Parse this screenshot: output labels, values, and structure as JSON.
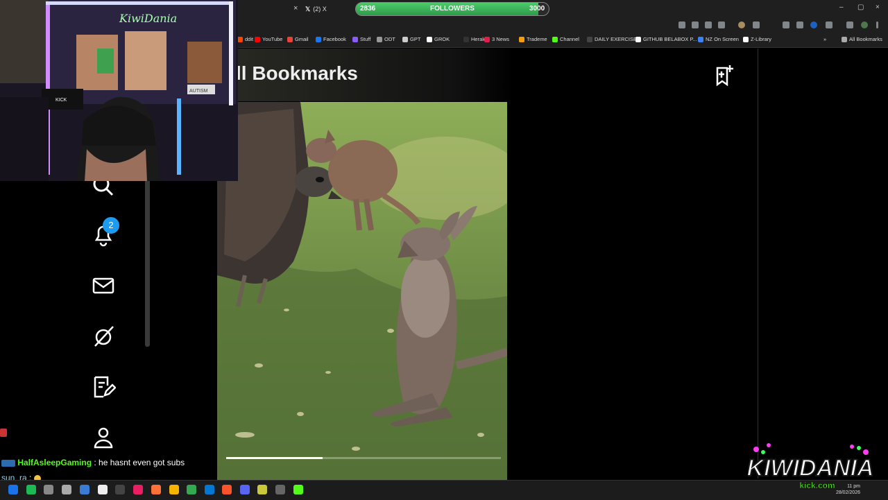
{
  "browser": {
    "tab_close": "×",
    "tab_label": "(2) X",
    "followers": {
      "current": "2836",
      "label": "FOLLOWERS",
      "goal": "3000",
      "fraction": 0.945
    },
    "window_controls": [
      "–",
      "▢",
      "×"
    ],
    "bookmarks": [
      {
        "label": "ddit",
        "color": "#ff4500"
      },
      {
        "label": "YouTube",
        "color": "#ff0000"
      },
      {
        "label": "Gmail",
        "color": "#ea4335"
      },
      {
        "label": "Facebook",
        "color": "#1877f2"
      },
      {
        "label": "Stuff",
        "color": "#8b5cf6"
      },
      {
        "label": "ODT",
        "color": "#999999"
      },
      {
        "label": "GPT",
        "color": "#cccccc"
      },
      {
        "label": "GROK",
        "color": "#ffffff"
      },
      {
        "label": "Herald",
        "color": "#333333"
      },
      {
        "label": "3 News",
        "color": "#e11d48"
      },
      {
        "label": "Trademe",
        "color": "#f59e0b"
      },
      {
        "label": "Channel",
        "color": "#53fc18"
      },
      {
        "label": "DAILY EXERCISE!",
        "color": "#444444"
      },
      {
        "label": "GITHUB BELABOX P...",
        "color": "#ffffff"
      },
      {
        "label": "NZ On Screen",
        "color": "#3b82f6"
      },
      {
        "label": "Z-Library",
        "color": "#ffffff"
      }
    ],
    "bookmarks_overflow": "»",
    "all_bookmarks": "All Bookmarks"
  },
  "page": {
    "title": "ll Bookmarks",
    "notification_count": "2"
  },
  "video": {
    "progress_fraction": 0.35
  },
  "chat": [
    {
      "user": "HalfAsleepGaming",
      "message": " : he hasnt even got subs"
    },
    {
      "user": "sun_ra",
      "message": " : "
    }
  ],
  "taskbar": {
    "time": "11 pm",
    "date": "28/02/2026"
  },
  "overlay": {
    "logo_text": "KIWIDANIA",
    "logo_sub": "kick.com",
    "webcam_sign": "KiwiDania"
  }
}
